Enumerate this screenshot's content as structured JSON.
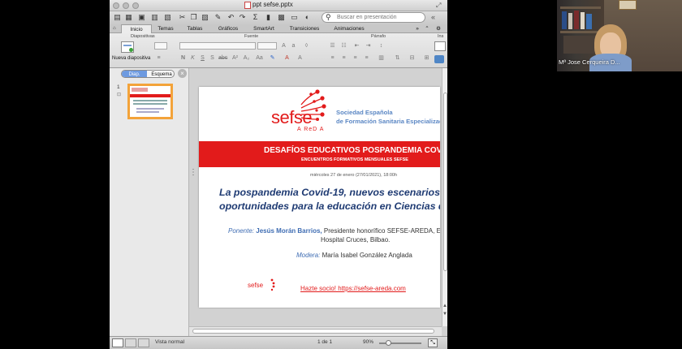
{
  "window": {
    "title": "ppt sefse.pptx"
  },
  "toolbar": {
    "search_placeholder": "Buscar en presentación"
  },
  "ribbon": {
    "tabs": [
      "Inicio",
      "Temas",
      "Tablas",
      "Gráficos",
      "SmartArt",
      "Transiciones",
      "Animaciones"
    ],
    "groups": {
      "slides": "Diapositivas",
      "font": "Fuente",
      "paragraph": "Párrafo",
      "insert": "Ins"
    },
    "new_slide_label": "Nueva diapositiva"
  },
  "pane": {
    "tab_slides": "Diap.",
    "tab_outline": "Esquema",
    "slide_number": "1"
  },
  "slide": {
    "brand_logo": "sefse",
    "brand_sub": "A ReD A",
    "society_line1": "Sociedad Española",
    "society_line2": "de Formación Sanitaria Especializada",
    "banner_title": "DESAFÍOS EDUCATIVOS POSPANDEMIA COVI",
    "banner_subtitle": "ENCUENTROS FORMATIVOS MENSUALES SEFSE",
    "date": "miércoles 27 de enero (27/01/2021), 18:00h",
    "headline1": "La pospandemia Covid-19, nuevos escenarios so",
    "headline2": "oportunidades para la educación en Ciencias de",
    "speaker_label": "Ponente:",
    "speaker_name": "Jesús Morán Barrios,",
    "speaker_role1": " Presidente honorífico SEFSE-AREDA, Exjef",
    "speaker_role2": "Hospital Cruces, Bilbao.",
    "moderator_label": "Modera:",
    "moderator_name": "María Isabel González Anglada",
    "join_text": "Hazte socio! https://sefse-areda.com"
  },
  "status": {
    "view": "Vista normal",
    "page": "1 de 1",
    "zoom": "90%"
  },
  "participant": {
    "name": "Mª Jose Cerqueira D..."
  },
  "colors": {
    "brand_red": "#e21b1b",
    "brand_blue": "#5b87c4",
    "accent_orange": "#f3a33a"
  }
}
